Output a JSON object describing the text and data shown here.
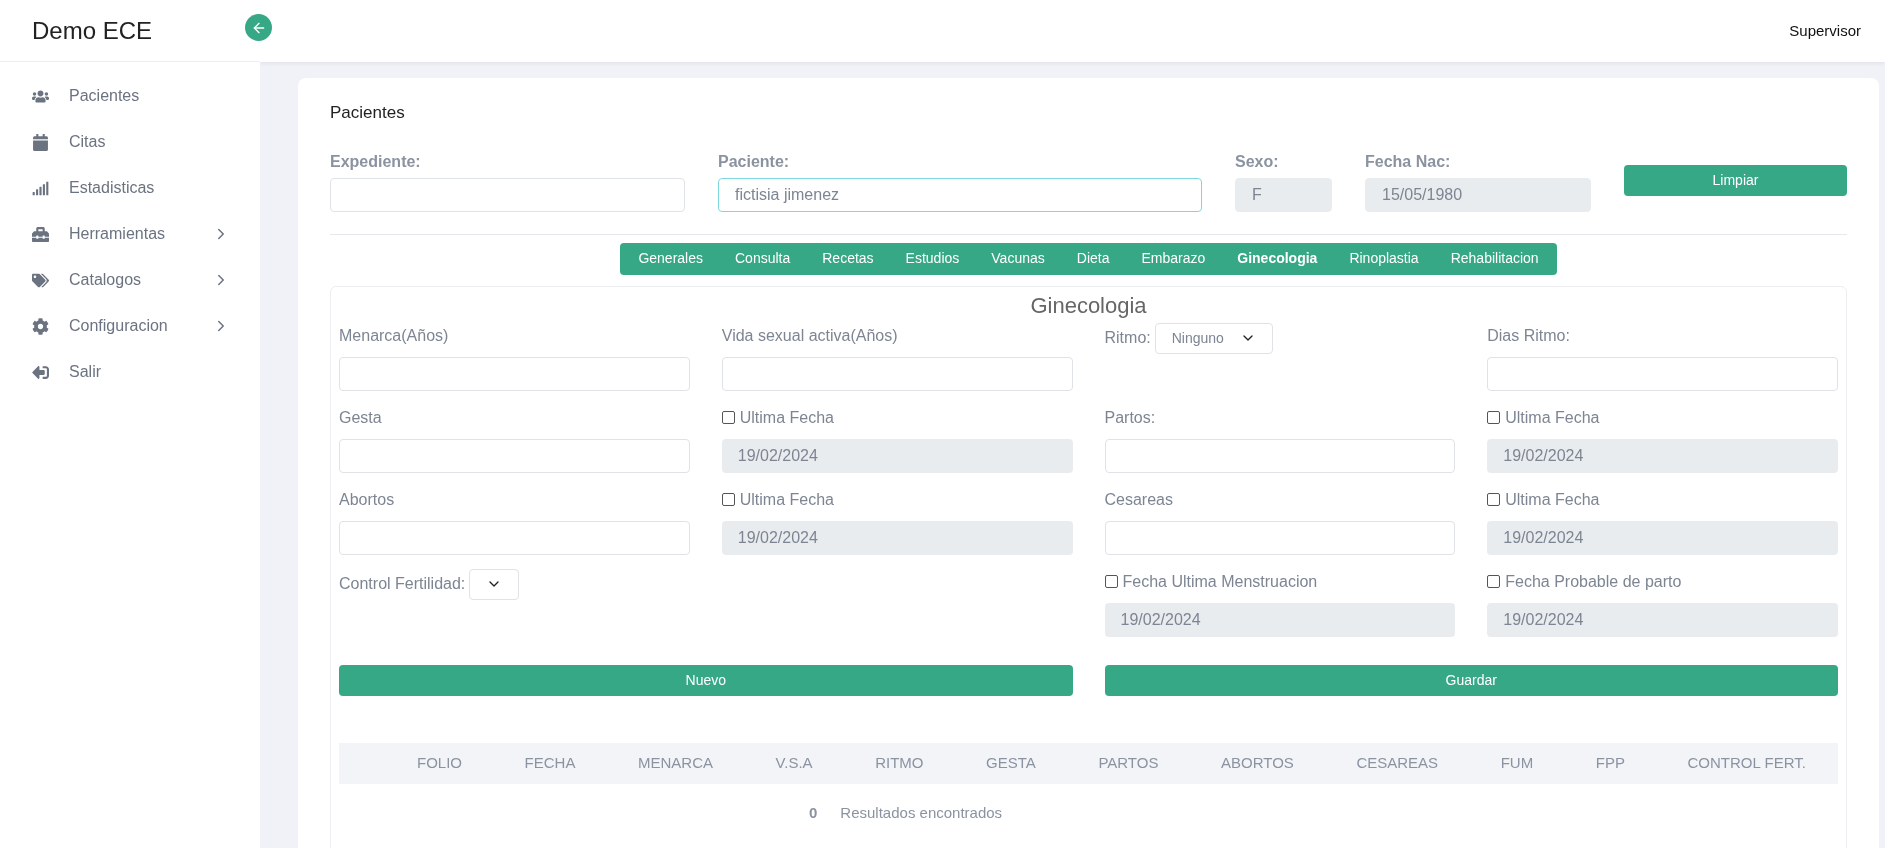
{
  "app_title": "Demo ECE",
  "sidebar": {
    "items": [
      {
        "label": "Pacientes",
        "has_submenu": false
      },
      {
        "label": "Citas",
        "has_submenu": false
      },
      {
        "label": "Estadisticas",
        "has_submenu": false
      },
      {
        "label": "Herramientas",
        "has_submenu": true
      },
      {
        "label": "Catalogos",
        "has_submenu": true
      },
      {
        "label": "Configuracion",
        "has_submenu": true
      },
      {
        "label": "Salir",
        "has_submenu": false
      }
    ]
  },
  "user": "Supervisor",
  "page_title": "Pacientes",
  "patient": {
    "fields": [
      {
        "label": "Expediente:",
        "disabled": false,
        "focused": false
      },
      {
        "label": "Paciente:",
        "value": "fictisia jimenez",
        "disabled": false,
        "focused": true
      },
      {
        "label": "Sexo:",
        "value": "F",
        "disabled": true,
        "focused": false
      },
      {
        "label": "Fecha Nac:",
        "value": "15/05/1980",
        "disabled": true,
        "focused": false
      }
    ],
    "clear_button": "Limpiar"
  },
  "tabs": [
    {
      "label": "Generales",
      "selected": false
    },
    {
      "label": "Consulta",
      "selected": false
    },
    {
      "label": "Recetas",
      "selected": false
    },
    {
      "label": "Estudios",
      "selected": false
    },
    {
      "label": "Vacunas",
      "selected": false
    },
    {
      "label": "Dieta",
      "selected": false
    },
    {
      "label": "Embarazo",
      "selected": false
    },
    {
      "label": "Ginecologia",
      "selected": true
    },
    {
      "label": "Rinoplastia",
      "selected": false
    },
    {
      "label": "Rehabilitacion",
      "selected": false
    }
  ],
  "section_title": "Ginecologia",
  "left_panel": {
    "fields": [
      {
        "kind": "text",
        "label": "Menarca(Años)"
      },
      {
        "kind": "text",
        "label": "Vida sexual activa(Años)"
      },
      {
        "kind": "text",
        "label": "Gesta"
      },
      {
        "kind": "dated",
        "label": "Ultima Fecha",
        "checked": false,
        "value": "19/02/2024"
      },
      {
        "kind": "text",
        "label": "Abortos"
      },
      {
        "kind": "dated",
        "label": "Ultima Fecha",
        "checked": false,
        "value": "19/02/2024"
      },
      {
        "kind": "select",
        "label": "Control Fertilidad:"
      }
    ],
    "button": "Nuevo"
  },
  "right_panel": {
    "fields": [
      {
        "kind": "select",
        "label": "Ritmo:",
        "value": "Ninguno"
      },
      {
        "kind": "text",
        "label": "Dias Ritmo:"
      },
      {
        "kind": "text",
        "label": "Partos:"
      },
      {
        "kind": "dated",
        "label": "Ultima Fecha",
        "checked": false,
        "value": "19/02/2024"
      },
      {
        "kind": "text",
        "label": "Cesareas"
      },
      {
        "kind": "dated",
        "label": "Ultima Fecha",
        "checked": false,
        "value": "19/02/2024"
      },
      {
        "kind": "dated",
        "label": "Fecha Ultima Menstruacion",
        "checked": false,
        "value": "19/02/2024"
      },
      {
        "kind": "dated",
        "label": "Fecha Probable de parto",
        "checked": false,
        "value": "19/02/2024"
      }
    ],
    "button": "Guardar"
  },
  "table": {
    "columns": [
      "FOLIO",
      "FECHA",
      "MENARCA",
      "V.S.A",
      "RITMO",
      "GESTA",
      "PARTOS",
      "ABORTOS",
      "CESAREAS",
      "FUM",
      "FPP",
      "CONTROL FERT."
    ]
  },
  "results": {
    "count": "0",
    "label": "Resultados encontrados"
  }
}
